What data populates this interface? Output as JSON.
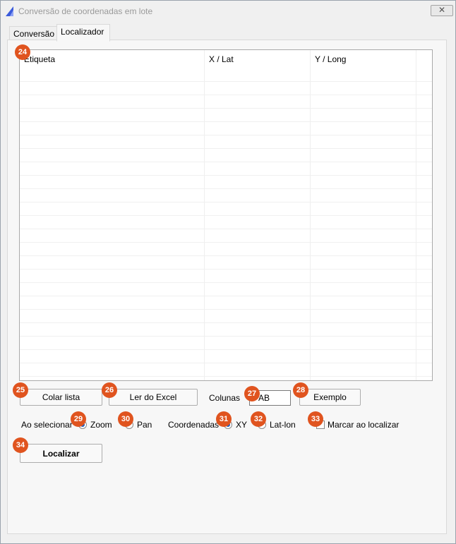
{
  "window": {
    "title": "Conversão de coordenadas em lote",
    "close_icon": "close-icon"
  },
  "tabs": [
    {
      "label": "Conversão",
      "active": false
    },
    {
      "label": "Localizador",
      "active": true
    }
  ],
  "grid": {
    "columns": [
      "Etiqueta",
      "X / Lat",
      "Y / Long"
    ],
    "rows": []
  },
  "controls": {
    "colar_lista": "Colar lista",
    "ler_excel": "Ler do Excel",
    "colunas_label": "Colunas",
    "colunas_value": "AB",
    "exemplo": "Exemplo",
    "ao_selecionar_label": "Ao selecionar",
    "zoom_label": "Zoom",
    "pan_label": "Pan",
    "coordenadas_label": "Coordenadas",
    "xy_label": "XY",
    "latlon_label": "Lat-lon",
    "marcar_label": "Marcar ao localizar",
    "localizar": "Localizar",
    "zoom_selected": true,
    "pan_selected": false,
    "xy_selected": true,
    "latlon_selected": false,
    "marcar_checked": false
  },
  "badges": {
    "b24": "24",
    "b25": "25",
    "b26": "26",
    "b27": "27",
    "b28": "28",
    "b29": "29",
    "b30": "30",
    "b31": "31",
    "b32": "32",
    "b33": "33",
    "b34": "34"
  },
  "colors": {
    "badge": "#e0541f",
    "radio_selected": "#1f5fbf"
  }
}
